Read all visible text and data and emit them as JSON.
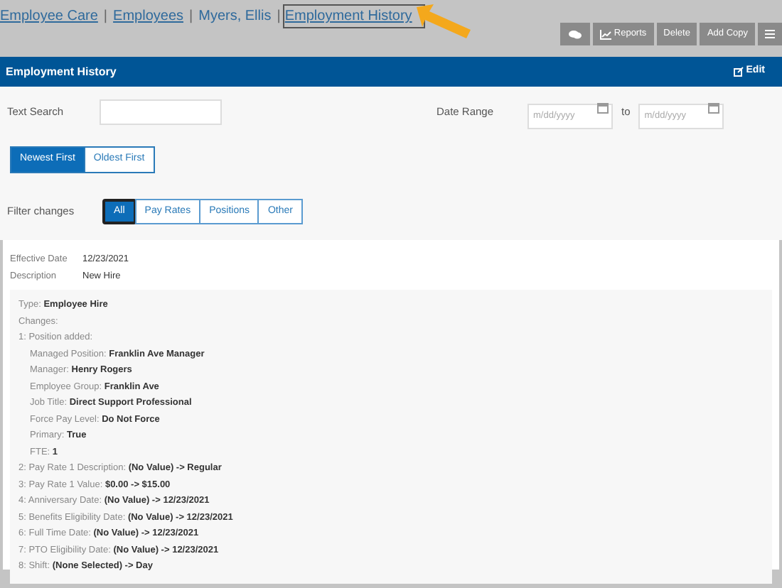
{
  "breadcrumb_separators": [
    "|",
    "|",
    "|"
  ],
  "breadcrumb": [
    {
      "label": "Employee Care",
      "kind": "link"
    },
    {
      "label": "Employees",
      "kind": "link"
    },
    {
      "label": "Myers, Ellis",
      "kind": "text"
    },
    {
      "label": "Employment History",
      "kind": "current"
    }
  ],
  "toolbar": [
    {
      "kind": "chat"
    },
    {
      "kind": "chart",
      "label": "Reports"
    },
    {
      "kind": "plain",
      "label": "Delete"
    },
    {
      "kind": "plain",
      "label": "Add Copy"
    },
    {
      "kind": "menu"
    }
  ],
  "panel": {
    "title": "Employment History",
    "action": "Edit"
  },
  "filters": {
    "text_search_label": "Text Search",
    "date_range_label": "Date Range",
    "date_from": {
      "placeholder": "m/dd/yyyy"
    },
    "to_label": "to",
    "date_to": {
      "placeholder": "m/dd/yyyy"
    }
  },
  "sort": [
    {
      "label": "Newest First",
      "selected": true
    },
    {
      "label": "Oldest First",
      "selected": false
    }
  ],
  "filter_changes": {
    "label": "Filter changes",
    "options": [
      {
        "label": "All",
        "selected": true
      },
      {
        "label": "Pay Rates",
        "selected": false
      },
      {
        "label": "Positions",
        "selected": false
      },
      {
        "label": "Other",
        "selected": false
      }
    ]
  },
  "entry": {
    "fields": [
      {
        "label": "Effective Date",
        "value": "12/23/2021"
      },
      {
        "label": "Description",
        "value": "New Hire"
      }
    ],
    "details": [
      {
        "text": "Type: **Employee Hire**"
      },
      {
        "text": "Changes:"
      },
      {
        "text": "1: Position added:",
        "children": [
          {
            "text": "Managed Position: **Franklin Ave Manager**"
          },
          {
            "text": "Manager: **Henry Rogers**"
          },
          {
            "text": "Employee Group: **Franklin Ave**"
          },
          {
            "text": "Job Title: **Direct Support Professional**"
          },
          {
            "text": "Force Pay Level: **Do Not Force**"
          },
          {
            "text": "Primary: **True**"
          },
          {
            "text": "FTE: **1**"
          }
        ]
      },
      {
        "text": "2: Pay Rate 1 Description: **(No Value) -> Regular**"
      },
      {
        "text": "3: Pay Rate 1 Value: **$0.00 -> $15.00**"
      },
      {
        "text": "4: Anniversary Date: **(No Value) -> 12/23/2021**"
      },
      {
        "text": "5: Benefits Eligibility Date: **(No Value) -> 12/23/2021**"
      },
      {
        "text": "6: Full Time Date: **(No Value) -> 12/23/2021**"
      },
      {
        "text": "7: PTO Eligibility Date: **(No Value) -> 12/23/2021**"
      },
      {
        "text": "8: Shift: **(None Selected) -> Day**"
      }
    ]
  }
}
